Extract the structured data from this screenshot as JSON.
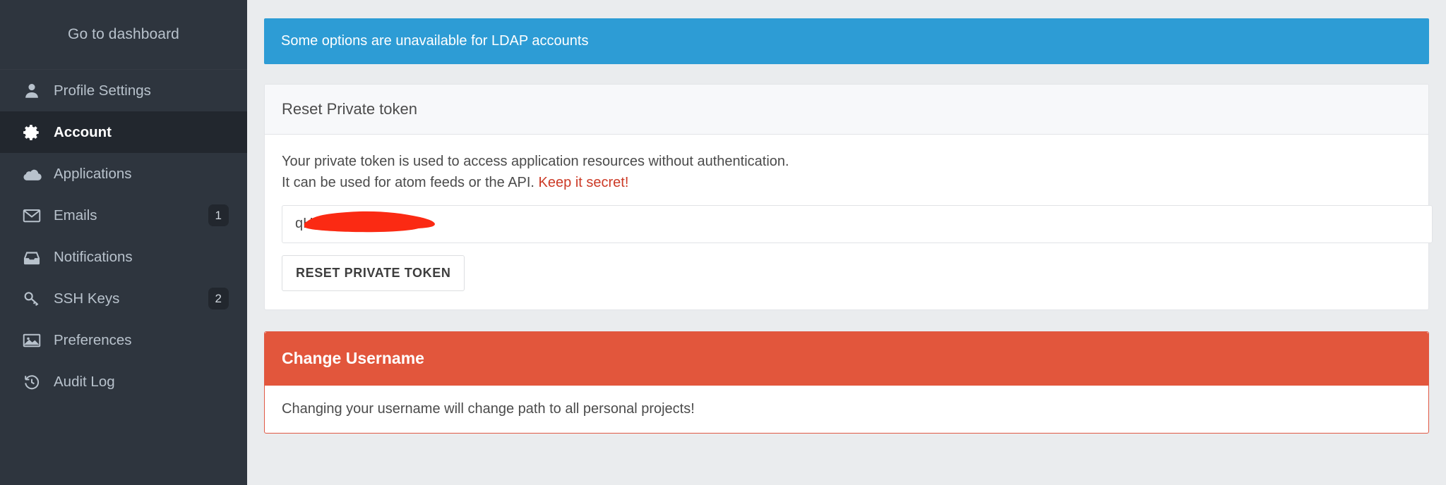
{
  "colors": {
    "sidebar_bg": "#2e353e",
    "sidebar_active_bg": "#22272e",
    "content_bg": "#eaecee",
    "alert_info": "#2d9cd5",
    "panel_danger": "#e2563c",
    "link_danger": "#cc3a26",
    "redaction": "#fb2a13"
  },
  "sidebar": {
    "dashboard_link": "Go to dashboard",
    "items": [
      {
        "label": "Profile Settings",
        "icon": "user-icon",
        "badge": "",
        "active": false
      },
      {
        "label": "Account",
        "icon": "gear-icon",
        "badge": "",
        "active": true
      },
      {
        "label": "Applications",
        "icon": "cloud-icon",
        "badge": "",
        "active": false
      },
      {
        "label": "Emails",
        "icon": "envelope-icon",
        "badge": "1",
        "active": false
      },
      {
        "label": "Notifications",
        "icon": "inbox-icon",
        "badge": "",
        "active": false
      },
      {
        "label": "SSH Keys",
        "icon": "key-icon",
        "badge": "2",
        "active": false
      },
      {
        "label": "Preferences",
        "icon": "image-icon",
        "badge": "",
        "active": false
      },
      {
        "label": "Audit Log",
        "icon": "history-icon",
        "badge": "",
        "active": false
      }
    ]
  },
  "main": {
    "alert": {
      "text": "Some options are unavailable for LDAP accounts"
    },
    "private_token_panel": {
      "title": "Reset Private token",
      "description_line1": "Your private token is used to access application resources without authentication.",
      "description_line2_prefix": "It can be used for atom feeds or the API. ",
      "description_line2_danger": "Keep it secret!",
      "token_value": "qH7",
      "token_placeholder": "",
      "reset_button": "RESET PRIVATE TOKEN"
    },
    "change_username_panel": {
      "title": "Change Username",
      "warning": "Changing your username will change path to all personal projects!"
    }
  }
}
